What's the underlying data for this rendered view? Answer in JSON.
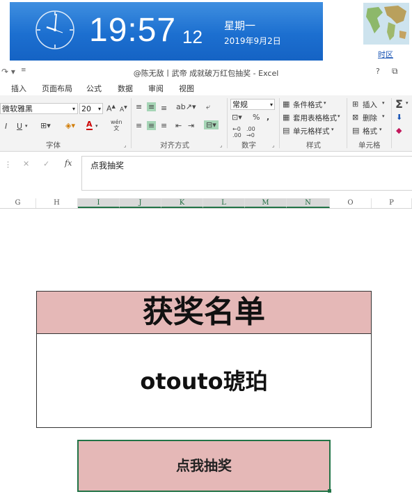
{
  "clock": {
    "time": "19:57",
    "seconds": "12",
    "weekday": "星期一",
    "date": "2019年9月2日",
    "timezone_link": "时区"
  },
  "window": {
    "title": "@陈无敌丨武帝 成就破万红包抽奖 - Excel",
    "help": "?"
  },
  "tabs": [
    "插入",
    "页面布局",
    "公式",
    "数据",
    "审阅",
    "视图"
  ],
  "ribbon": {
    "font_name": "微软雅黑",
    "font_size": "20",
    "phonetic": "wén\n文",
    "number_format": "常规",
    "percent": "%",
    "comma": ",",
    "conditional_format": "条件格式",
    "table_format": "套用表格格式",
    "cell_style": "单元格样式",
    "insert": "插入",
    "delete": "删除",
    "format": "格式",
    "groups": {
      "font": "字体",
      "alignment": "对齐方式",
      "number": "数字",
      "styles": "样式",
      "cells": "单元格"
    }
  },
  "formula_bar": {
    "content": "点我抽奖"
  },
  "columns": [
    "G",
    "H",
    "I",
    "J",
    "K",
    "L",
    "M",
    "N",
    "O",
    "P"
  ],
  "sheet": {
    "title": "获奖名单",
    "winner": "otouto琥珀",
    "button": "点我抽奖"
  },
  "colors": {
    "clock_bg": "#1c6fd0",
    "cell_pink": "#e5b8b7",
    "excel_green": "#217346",
    "alignment_active": "#a6d5b6"
  }
}
